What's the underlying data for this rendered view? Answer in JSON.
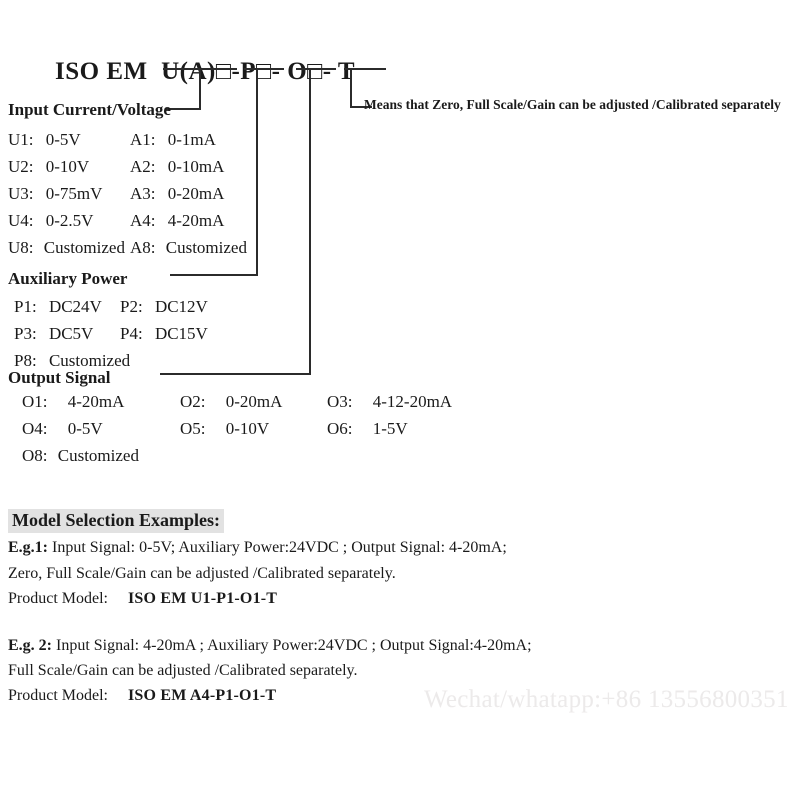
{
  "model_code": {
    "prefix": "ISO EM",
    "input_part": "U(A)□",
    "sep1": "-",
    "power_part": "P□",
    "sep2": "- ",
    "output_part": "O□",
    "sep3": "- ",
    "suffix": "T",
    "full": "ISO EM  U(A)□-P□- O□- T"
  },
  "annotation": {
    "means_note": "Means that Zero, Full Scale/Gain can be adjusted /Calibrated separately"
  },
  "sections": {
    "input": {
      "heading": "Input Current/Voltage",
      "voltage_options": [
        {
          "code": "U1:",
          "value": "0-5V"
        },
        {
          "code": "U2:",
          "value": "0-10V"
        },
        {
          "code": "U3:",
          "value": "0-75mV"
        },
        {
          "code": "U4:",
          "value": "0-2.5V"
        },
        {
          "code": "U8:",
          "value": "Customized"
        }
      ],
      "current_options": [
        {
          "code": "A1:",
          "value": "0-1mA"
        },
        {
          "code": "A2:",
          "value": "0-10mA"
        },
        {
          "code": "A3:",
          "value": "0-20mA"
        },
        {
          "code": "A4:",
          "value": "4-20mA"
        },
        {
          "code": "A8:",
          "value": "Customized"
        }
      ]
    },
    "power": {
      "heading": "Auxiliary Power",
      "col1": [
        {
          "code": "P1:",
          "value": "DC24V"
        },
        {
          "code": "P3:",
          "value": "DC5V"
        },
        {
          "code": "P8:",
          "value": "Customized"
        }
      ],
      "col2": [
        {
          "code": "P2:",
          "value": "DC12V"
        },
        {
          "code": "P4:",
          "value": "DC15V"
        }
      ]
    },
    "output": {
      "heading": "Output Signal",
      "col1": [
        {
          "code": "O1:",
          "value": "4-20mA"
        },
        {
          "code": "O4:",
          "value": "0-5V"
        },
        {
          "code": "O8:",
          "value": "Customized"
        }
      ],
      "col2": [
        {
          "code": "O2:",
          "value": "0-20mA"
        },
        {
          "code": "O5:",
          "value": "0-10V"
        }
      ],
      "col3": [
        {
          "code": "O3:",
          "value": "4-12-20mA"
        },
        {
          "code": "O6:",
          "value": "1-5V"
        }
      ]
    }
  },
  "examples": {
    "heading": "Model Selection Examples:",
    "items": [
      {
        "tag": "E.g.1:",
        "spec": " Input Signal: 0-5V; Auxiliary Power:24VDC ; Output Signal: 4-20mA;",
        "note": "Zero, Full Scale/Gain can be adjusted /Calibrated separately.",
        "model_label": "Product Model:",
        "model_value": "ISO EM U1-P1-O1-T"
      },
      {
        "tag": "E.g. 2:",
        "spec": " Input Signal: 4-20mA ; Auxiliary Power:24VDC ; Output Signal:4-20mA;",
        "note": "Full Scale/Gain can be adjusted /Calibrated separately.",
        "model_label": "Product Model:",
        "model_value": "ISO EM A4-P1-O1-T"
      }
    ]
  },
  "watermark": {
    "text": "Wechat/whatapp:+86 13556800351"
  },
  "colors": {
    "line": "#2b2b2b",
    "text": "#1a1a1a",
    "highlight": "#e2e2e2",
    "watermark": "#eceaea"
  }
}
